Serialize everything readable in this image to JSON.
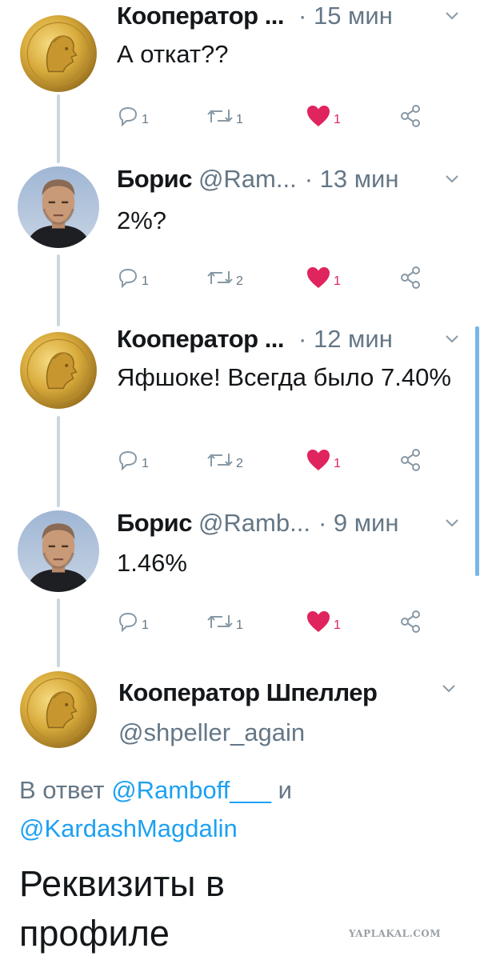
{
  "thread": [
    {
      "avatar": "gold-coin-avatar",
      "name": "Кооператор ...",
      "handle": "",
      "time": "· 15 мин",
      "text": "А откат??",
      "replies": "1",
      "retweets": "1",
      "likes": "1"
    },
    {
      "avatar": "man-photo-avatar",
      "name": "Борис",
      "handle": "@Ram...",
      "time": "· 13 мин",
      "text": "2%?",
      "replies": "1",
      "retweets": "2",
      "likes": "1"
    },
    {
      "avatar": "gold-coin-avatar",
      "name": "Кооператор ...",
      "handle": "",
      "time": "· 12 мин",
      "text": "Яфшоке! Всегда было 7.40%",
      "replies": "1",
      "retweets": "2",
      "likes": "1"
    },
    {
      "avatar": "man-photo-avatar",
      "name": "Борис",
      "handle": "@Ramb...",
      "time": "· 9 мин",
      "text": "1.46%",
      "replies": "1",
      "retweets": "1",
      "likes": "1"
    }
  ],
  "main": {
    "avatar": "gold-coin-avatar",
    "name": "Кооператор Шпеллер",
    "handle": "@shpeller_again",
    "reply_prefix": "В ответ",
    "reply_mention_1": "@Ramboff___",
    "reply_and": "и",
    "reply_mention_2": "@KardashMagdalin",
    "text": "Реквизиты в профиле"
  },
  "watermark": "YAPLAKAL.COM",
  "colors": {
    "like": "#e0245e",
    "link": "#1da1f2",
    "secondary": "#657786",
    "thread_line": "#ccd6dd"
  }
}
